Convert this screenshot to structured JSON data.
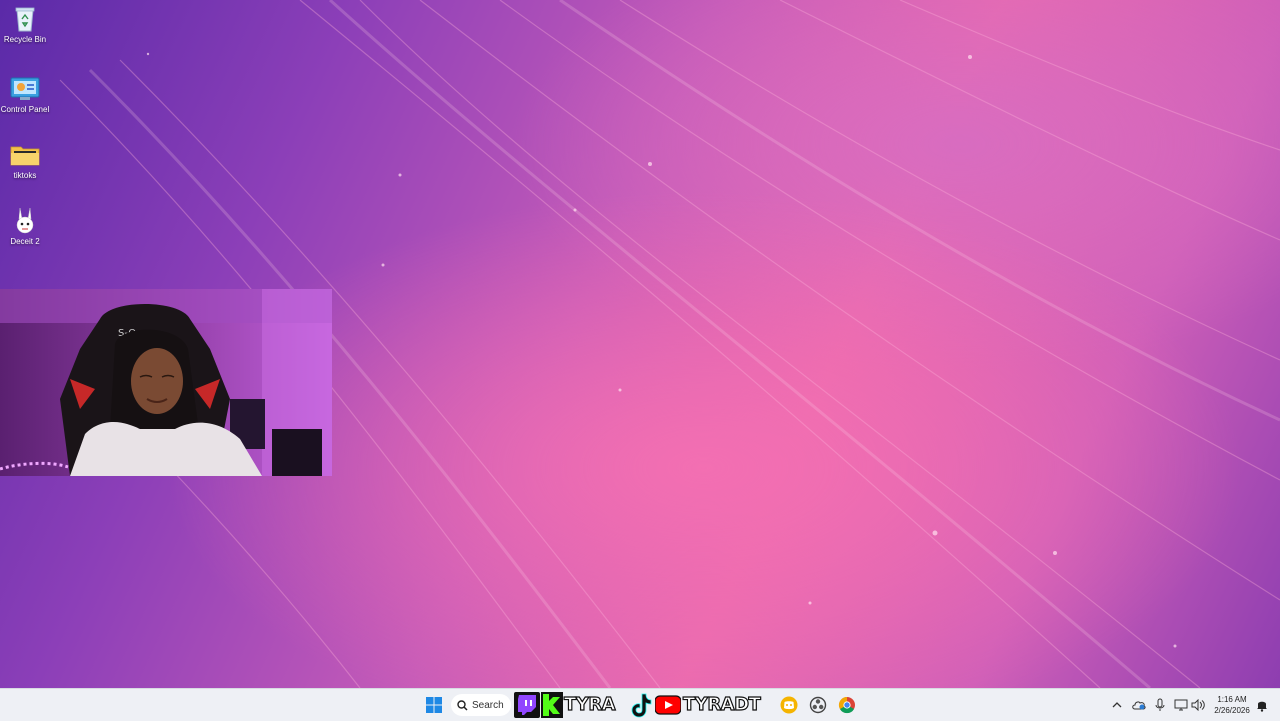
{
  "desktop": {
    "icons": [
      {
        "label": "Recycle Bin",
        "icon": "recycle-bin-icon"
      },
      {
        "label": "Control Panel",
        "icon": "control-panel-icon"
      },
      {
        "label": "tiktoks",
        "icon": "folder-icon"
      },
      {
        "label": "Deceit 2",
        "icon": "deceit-bunny-icon"
      }
    ]
  },
  "taskbar": {
    "search_label": "Search",
    "banner": {
      "kick_handle": "TYRA",
      "youtube_handle": "TYRADT"
    },
    "clock": {
      "time": "1:16 AM",
      "date": "2/26/2026"
    }
  },
  "colors": {
    "twitch": "#9146ff",
    "kick": "#53fc18",
    "youtube": "#ff0000",
    "discord": "#f5b400",
    "taskbar_bg": "#eef0f5"
  }
}
